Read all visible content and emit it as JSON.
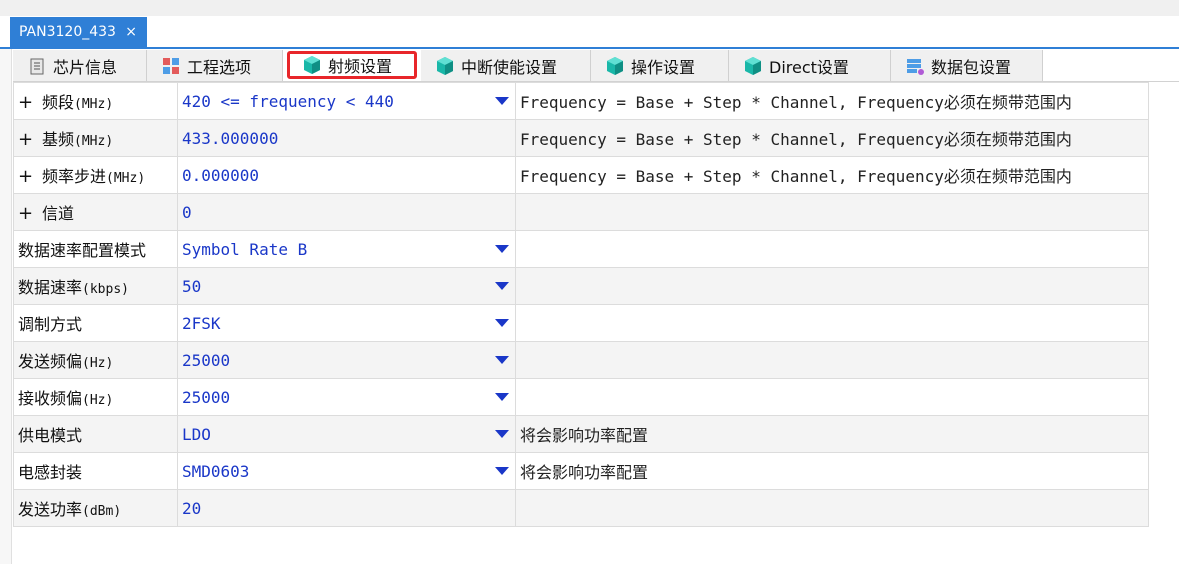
{
  "document_tab": {
    "title": "PAN3120_433",
    "close": "×"
  },
  "tabs": [
    {
      "label": "芯片信息",
      "icon": "chip-info-icon"
    },
    {
      "label": "工程选项",
      "icon": "project-options-icon"
    },
    {
      "label": "射频设置",
      "icon": "cube-icon",
      "active": true
    },
    {
      "label": "中断使能设置",
      "icon": "cube-icon"
    },
    {
      "label": "操作设置",
      "icon": "cube-icon"
    },
    {
      "label": "Direct设置",
      "icon": "cube-icon"
    },
    {
      "label": "数据包设置",
      "icon": "packet-settings-icon"
    }
  ],
  "rows": [
    {
      "expand": "+",
      "name": "频段",
      "unit": "(MHz)",
      "value": "420 <= frequency < 440",
      "dropdown": true,
      "desc": "Frequency = Base + Step * Channel, Frequency必须在频带范围内"
    },
    {
      "expand": "+",
      "name": "基频",
      "unit": "(MHz)",
      "value": "433.000000",
      "dropdown": false,
      "desc": "Frequency = Base + Step * Channel, Frequency必须在频带范围内"
    },
    {
      "expand": "+",
      "name": "频率步进",
      "unit": "(MHz)",
      "value": "0.000000",
      "dropdown": false,
      "desc": "Frequency = Base + Step * Channel, Frequency必须在频带范围内"
    },
    {
      "expand": "+",
      "name": "信道",
      "unit": "",
      "value": "0",
      "dropdown": false,
      "desc": ""
    },
    {
      "expand": "",
      "name": "数据速率配置模式",
      "unit": "",
      "value": "Symbol Rate B",
      "dropdown": true,
      "desc": ""
    },
    {
      "expand": "",
      "name": "数据速率",
      "unit": "(kbps)",
      "value": "50",
      "dropdown": true,
      "desc": ""
    },
    {
      "expand": "",
      "name": "调制方式",
      "unit": "",
      "value": "2FSK",
      "dropdown": true,
      "desc": ""
    },
    {
      "expand": "",
      "name": "发送频偏",
      "unit": "(Hz)",
      "value": "25000",
      "dropdown": true,
      "desc": ""
    },
    {
      "expand": "",
      "name": "接收频偏",
      "unit": "(Hz)",
      "value": "25000",
      "dropdown": true,
      "desc": ""
    },
    {
      "expand": "",
      "name": "供电模式",
      "unit": "",
      "value": "LDO",
      "dropdown": true,
      "desc": "将会影响功率配置"
    },
    {
      "expand": "",
      "name": "电感封装",
      "unit": "",
      "value": "SMD0603",
      "dropdown": true,
      "desc": "将会影响功率配置"
    },
    {
      "expand": "",
      "name": "发送功率",
      "unit": "(dBm)",
      "value": "20",
      "dropdown": false,
      "desc": ""
    }
  ],
  "colors": {
    "accent": "#2f7fd6",
    "value_text": "#1a37c8",
    "highlight": "#e8262a",
    "cube": "#19b7a8"
  }
}
